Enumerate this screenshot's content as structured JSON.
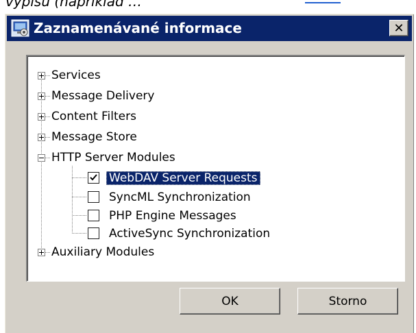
{
  "top_strip": {
    "clipped_text": "partial text (cut off)"
  },
  "dialog": {
    "title": "Zaznamenávané informace",
    "close_glyph": "✕"
  },
  "tree": {
    "nodes": [
      {
        "label": "Services",
        "state": "collapsed"
      },
      {
        "label": "Message Delivery",
        "state": "collapsed"
      },
      {
        "label": "Content Filters",
        "state": "collapsed"
      },
      {
        "label": "Message Store",
        "state": "collapsed"
      },
      {
        "label": "HTTP Server Modules",
        "state": "expanded",
        "children": [
          {
            "label": "WebDAV Server Requests",
            "checked": true,
            "selected": true
          },
          {
            "label": "SyncML Synchronization",
            "checked": false,
            "selected": false
          },
          {
            "label": "PHP Engine Messages",
            "checked": false,
            "selected": false
          },
          {
            "label": "ActiveSync Synchronization",
            "checked": false,
            "selected": false
          }
        ]
      },
      {
        "label": "Auxiliary Modules",
        "state": "collapsed"
      }
    ]
  },
  "buttons": {
    "ok": "OK",
    "cancel": "Storno"
  },
  "colors": {
    "title_bar": "#0a246a",
    "selection": "#0a246a",
    "dialog_face": "#d4d0c8"
  },
  "icons": {
    "app": "dialog-app-icon",
    "close": "close-icon",
    "expander": "tree-expander-icon",
    "checkbox": "checkbox-icon"
  }
}
